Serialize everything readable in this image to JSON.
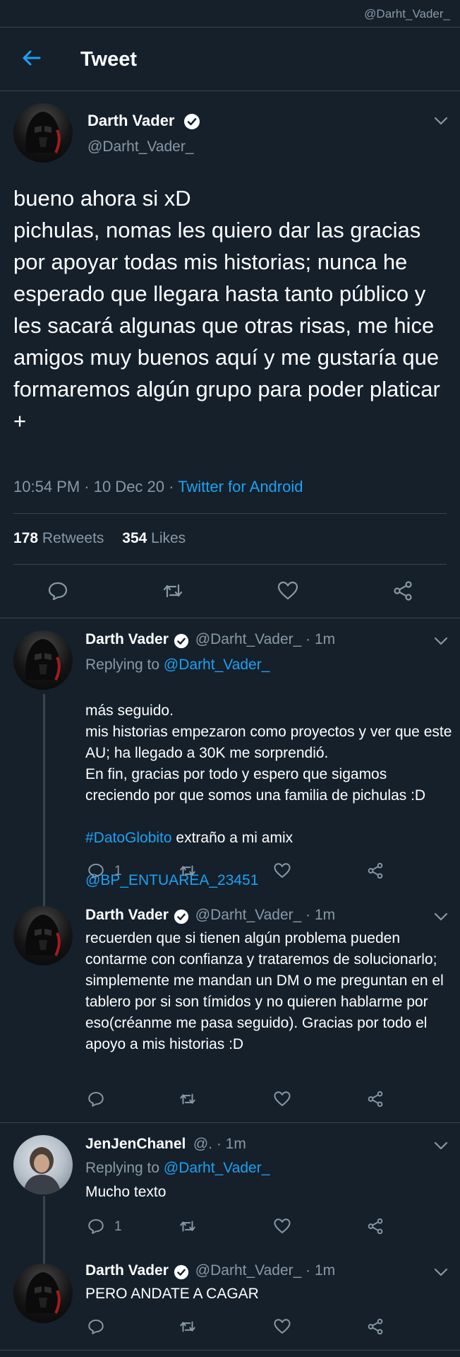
{
  "watermark": "@Darht_Vader_",
  "header": {
    "title": "Tweet",
    "back_icon": "arrow-left-icon"
  },
  "accent": "#1da1f2",
  "main_tweet": {
    "name": "Darth Vader",
    "handle": "@Darht_Vader_",
    "text": "bueno ahora si xD\npichulas, nomas les quiero dar las gracias por apoyar todas mis historias; nunca he esperado que llegara hasta tanto público y les sacará algunas que otras risas, me hice amigos muy buenos aquí y me gustaría que formaremos algún grupo para poder platicar +",
    "time": "10:54 PM · 10 Dec 20 · ",
    "source": "Twitter for Android",
    "retweets": "178",
    "retweets_label": " Retweets",
    "likes": "354",
    "likes_label": " Likes"
  },
  "replies": [
    {
      "name": "Darth Vader",
      "handle": "@Darht_Vader_ · 1m",
      "replying_prefix": "Replying to ",
      "replying_to": "@Darht_Vader_",
      "text": "más seguido.\nmis historias empezaron como proyectos y ver que este AU; ha llegado a 30K me sorprendió.\nEn fin, gracias por todo y espero que sigamos creciendo por que somos una familia de pichulas :D",
      "hashtag": "#DatoGlobito",
      "hashtag_tail": " extraño a mi amix",
      "mention": "@BP_ENTUAREA_23451",
      "reply_count": "1"
    },
    {
      "name": "Darth Vader",
      "handle": "@Darht_Vader_ · 1m",
      "text": "recuerden que si tienen algún problema pueden contarme con confianza y trataremos de solucionarlo; simplemente me mandan un DM o me preguntan  en el tablero por si son tímidos y no quieren hablarme por eso(créanme me pasa seguido). Gracias por todo el apoyo a mis historias :D"
    },
    {
      "name": "JenJenChanel",
      "handle": "@. · 1m",
      "replying_prefix": "Replying to ",
      "replying_to": "@Darht_Vader_",
      "text": "Mucho texto",
      "reply_count": "1"
    },
    {
      "name": "Darth Vader",
      "handle": "@Darht_Vader_ · 1m",
      "text": "PERO ANDATE A CAGAR"
    }
  ]
}
